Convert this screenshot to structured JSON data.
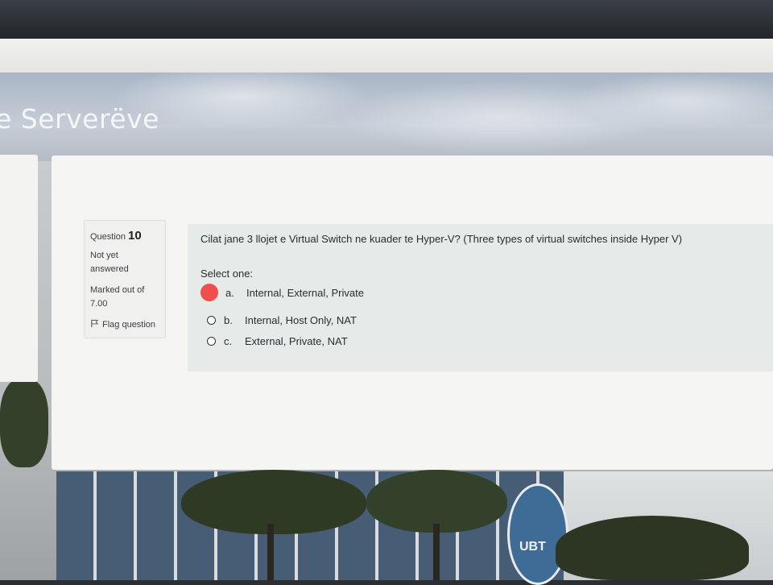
{
  "site": {
    "title": "e Serverëve"
  },
  "question": {
    "label": "Question",
    "number": "10",
    "state": "Not yet answered",
    "grade": "Marked out of 7.00",
    "flag_label": "Flag question",
    "text": "Cilat jane 3 llojet e Virtual Switch ne kuader te Hyper-V? (Three types of virtual switches inside Hyper V)",
    "prompt": "Select one:",
    "options": [
      {
        "letter": "a.",
        "text": "Internal, External, Private",
        "selected": true
      },
      {
        "letter": "b.",
        "text": "Internal, Host Only, NAT",
        "selected": false
      },
      {
        "letter": "c.",
        "text": "External, Private, NAT",
        "selected": false
      }
    ]
  },
  "background": {
    "logo_text": "UBT"
  },
  "colors": {
    "selected_radio": "#f04d4d"
  }
}
